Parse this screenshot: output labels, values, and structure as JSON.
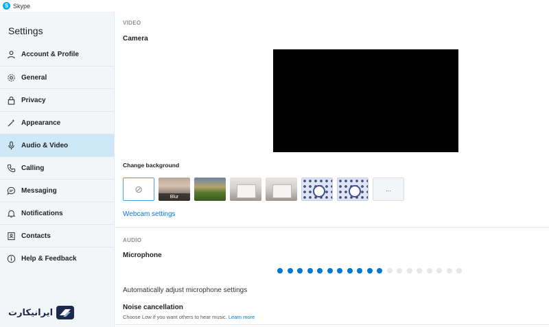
{
  "window": {
    "title": "Skype"
  },
  "sidebar": {
    "heading": "Settings",
    "items": [
      {
        "label": "Account & Profile",
        "icon": "person-icon",
        "active": false
      },
      {
        "label": "General",
        "icon": "gear-icon",
        "active": false
      },
      {
        "label": "Privacy",
        "icon": "lock-icon",
        "active": false
      },
      {
        "label": "Appearance",
        "icon": "magic-wand-icon",
        "active": false
      },
      {
        "label": "Audio & Video",
        "icon": "microphone-icon",
        "active": true
      },
      {
        "label": "Calling",
        "icon": "phone-icon",
        "active": false
      },
      {
        "label": "Messaging",
        "icon": "chat-bubble-icon",
        "active": false
      },
      {
        "label": "Notifications",
        "icon": "bell-icon",
        "active": false
      },
      {
        "label": "Contacts",
        "icon": "contact-card-icon",
        "active": false
      },
      {
        "label": "Help & Feedback",
        "icon": "info-icon",
        "active": false
      }
    ],
    "brand_text": "ایرانیکارت"
  },
  "video": {
    "section_label": "VIDEO",
    "camera_label": "Camera",
    "change_background_label": "Change background",
    "backgrounds": [
      {
        "id": "none",
        "label": ""
      },
      {
        "id": "blur",
        "label": "Blur"
      },
      {
        "id": "landscape",
        "label": ""
      },
      {
        "id": "room-1",
        "label": ""
      },
      {
        "id": "room-2",
        "label": ""
      },
      {
        "id": "pattern-1",
        "label": ""
      },
      {
        "id": "pattern-2",
        "label": ""
      },
      {
        "id": "more",
        "label": "..."
      }
    ],
    "webcam_settings_link": "Webcam settings"
  },
  "audio": {
    "section_label": "AUDIO",
    "microphone_label": "Microphone",
    "mic_level": {
      "active_dots": 11,
      "total_dots": 19
    },
    "auto_adjust_label": "Automatically adjust microphone settings",
    "noise_cancellation_label": "Noise cancellation",
    "noise_cancellation_hint": "Choose Low if you want others to hear music.",
    "learn_more_link": "Learn more"
  },
  "colors": {
    "accent": "#0078d4",
    "active_nav": "#cfe8f8",
    "mic_active": "#0078d4",
    "mic_inactive": "#e5e7ea"
  }
}
